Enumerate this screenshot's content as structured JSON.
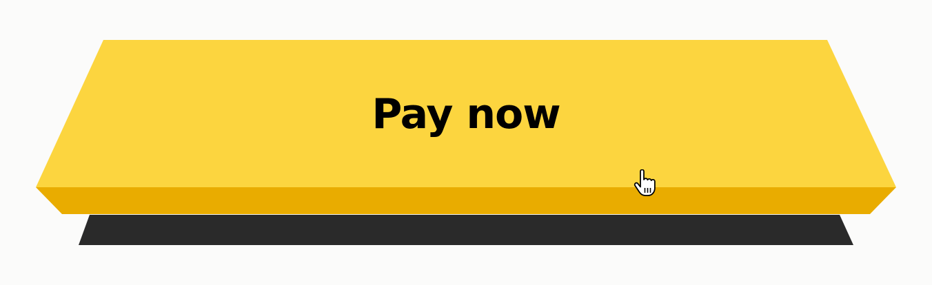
{
  "button": {
    "label": "Pay now",
    "face_color": "#fcd53f",
    "edge_color": "#e9ac00",
    "shadow_color": "#2a2a2a",
    "text_color": "#000000"
  },
  "cursor": {
    "icon": "hand-pointer-icon"
  },
  "background_color": "#fbfbfa"
}
